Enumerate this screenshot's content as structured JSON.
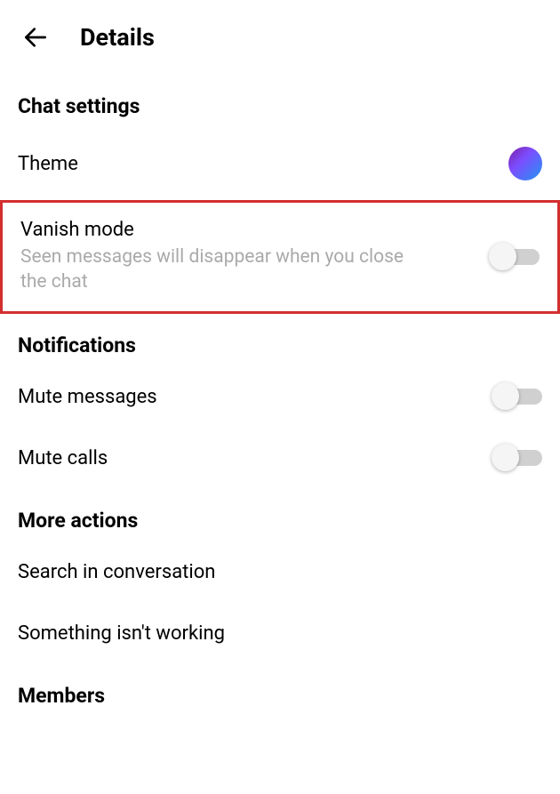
{
  "header": {
    "title": "Details"
  },
  "sections": {
    "chatSettings": {
      "header": "Chat settings",
      "theme": {
        "label": "Theme"
      },
      "vanishMode": {
        "label": "Vanish mode",
        "description": "Seen messages will disappear when you close the chat"
      }
    },
    "notifications": {
      "header": "Notifications",
      "muteMessages": {
        "label": "Mute messages"
      },
      "muteCalls": {
        "label": "Mute calls"
      }
    },
    "moreActions": {
      "header": "More actions",
      "search": {
        "label": "Search in conversation"
      },
      "report": {
        "label": "Something isn't working"
      }
    },
    "members": {
      "header": "Members"
    }
  }
}
